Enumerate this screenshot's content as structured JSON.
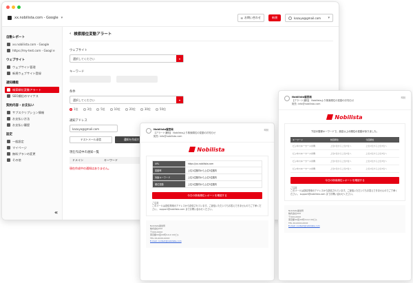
{
  "app": {
    "site_selector": "xx.nobilista.com - Google",
    "inquiry_button": "お問い合わせ",
    "signup_button": "新規",
    "user_email": "kazuyo@gmail.com"
  },
  "sidebar": {
    "sections": [
      {
        "title": "自動レポート",
        "items": [
          {
            "label": "xx.nobilista.com - Google"
          },
          {
            "label": "https://my-test.com - Googl e"
          }
        ]
      },
      {
        "title": "ウェブサイト",
        "items": [
          {
            "label": "ウェブサイト管理"
          },
          {
            "label": "新規ウェブサイト登録"
          }
        ]
      },
      {
        "title": "通知機能",
        "items": [
          {
            "label": "検索順位変動アラート",
            "active": true
          },
          {
            "label": "SEO順位のマイナス"
          }
        ]
      },
      {
        "title": "契約内容・お支払い",
        "items": [
          {
            "label": "サブスクリプション情報"
          },
          {
            "label": "お支払い方法"
          },
          {
            "label": "お支払い履歴"
          }
        ]
      },
      {
        "title": "設定",
        "items": [
          {
            "label": "一般設定"
          },
          {
            "label": "マイページ"
          },
          {
            "label": "無料プランの変更"
          },
          {
            "label": "その他"
          }
        ]
      }
    ]
  },
  "main": {
    "title": "検索順位変動アラート",
    "website_label": "ウェブサイト",
    "website_placeholder": "選択してください",
    "keyword_label": "キーワード",
    "condition_label": "条件",
    "condition_placeholder": "選択してください",
    "radio_options": [
      "1位",
      "3位",
      "5位",
      "10位",
      "20位",
      "30位",
      "50位"
    ],
    "email_label": "通知アドレス",
    "email_value": "kazuyo@gmail.com",
    "test_button": "テストメール送信",
    "save_button": "通知を作成する",
    "list_label": "現在作成中の通知一覧",
    "table_headers": [
      "ドメイン",
      "キーワード"
    ],
    "empty_message": "現在作成中の通知はありません。"
  },
  "email1": {
    "sender": "Nobilista運営局",
    "subject": "【アラート通知】 Nobilistaより検索順位の変動のお知らせ",
    "to": "宛先: info@nobilista.com",
    "time": "時刻",
    "brand": "Nobilista",
    "rows": [
      {
        "k": "URL",
        "v": "https://xx.nobilista.com"
      },
      {
        "k": "変動率",
        "v": "上位1位圏内から上位3位圏内"
      },
      {
        "k": "対象キーワード",
        "v": "上位1位圏内から上位3位圏内"
      },
      {
        "k": "順位変動",
        "v": "上位1位圏内から上位3位圏内"
      }
    ],
    "cta": "今日の検索順位レポートを確認する",
    "note_title": "ご注意",
    "note_body": "このメールは送信専用のアドレスから送信されています。ご返信いただいてもお答えできませんのでご了承ください。 support@nobilista.com までお問い合わせください。",
    "footer_company": "Nobilista運営局",
    "footer_lines": [
      "株式会社XXX",
      "〒XXX-XXXX",
      "東京都XX区XX町X-X-X XXビル",
      "TEL XX-XXXX-XXXX"
    ],
    "footer_email": "E-mail: contact@nobilista.com"
  },
  "email2": {
    "sender": "Nobilista運営局",
    "subject": "【アラート通知】 Nobilistaより検索順位の変動のお知らせ",
    "to": "宛先: info@nobilista.com",
    "time": "時刻",
    "brand": "Nobilista",
    "intro": "下記の登録キーワードで、設定以上の順位の変動がありました。",
    "headers": [
      "キーワード",
      "前回順位",
      "今回順位"
    ],
    "rows": [
      {
        "kw": "ビジネスキーワードの例",
        "prev": "上位1位から上位3位へ",
        "cur": "上位1位から上位3位へ"
      },
      {
        "kw": "ビジネスキーワードの例",
        "prev": "上位1位から上位3位へ",
        "cur": "上位1位から上位3位へ"
      },
      {
        "kw": "ビジネスキーワードの例",
        "prev": "上位1位から上位3位へ",
        "cur": "上位1位から上位3位へ"
      },
      {
        "kw": "ビジネスキーワードの例",
        "prev": "上位1位から上位3位へ",
        "cur": "上位1位から上位3位へ"
      }
    ],
    "cta": "今日の検索順位レポートを確認する",
    "note_title": "ご注意",
    "note_body": "このメールは送信専用のアドレスから送信されています。ご返信いただいてもお答えできませんのでご了承ください。 support@nobilista.com までお問い合わせください。",
    "footer_company": "Nobilista運営局",
    "footer_lines": [
      "株式会社XXX",
      "〒XXX-XXXX",
      "東京都XX区XX町X-X-X XXビル",
      "TEL XX-XXXX-XXXX"
    ],
    "footer_email": "E-mail: contact@nobilista.com"
  }
}
